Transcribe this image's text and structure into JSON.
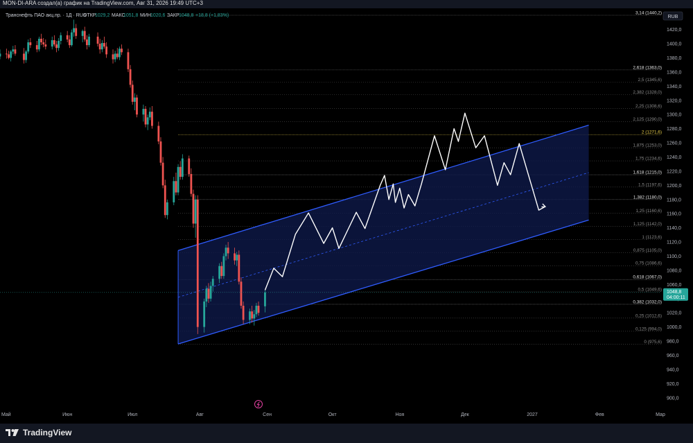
{
  "header": {
    "attribution": "MON-DI-ARA создал(а) график на TradingView.com, Авг 31, 2026 19:49 UTC+3"
  },
  "legend": {
    "symbol": "Транснефть ПАО акц.пр. · 1Д · RUS",
    "open_label": "ОТКР",
    "open": "1029,2",
    "high_label": "МАКС",
    "high": "1051,8",
    "low_label": "МИН",
    "low": "1020,6",
    "close_label": "ЗАКР",
    "close": "1048,8",
    "change": "+18,8 (+1,83%)"
  },
  "footer": {
    "brand": "TradingView"
  },
  "colors": {
    "background": "#000000",
    "up": "#26a69a",
    "down": "#ef5350",
    "channel_line": "#2f5cff",
    "channel_fill": "#0e1a4a",
    "forecast": "#ffffff",
    "fib_line": "#8a8a8a",
    "price_tag": "#26a69a"
  },
  "chart_data": {
    "type": "candlestick",
    "currency": "RUB",
    "y_axis": {
      "range": [
        890,
        1450
      ],
      "ticks": [
        "1420,0",
        "1400,0",
        "1380,0",
        "1360,0",
        "1340,0",
        "1320,0",
        "1300,0",
        "1280,0",
        "1260,0",
        "1240,0",
        "1220,0",
        "1200,0",
        "1180,0",
        "1160,0",
        "1140,0",
        "1120,0",
        "1100,0",
        "1080,0",
        "1060,0",
        "1040,0",
        "1020,0",
        "1000,0",
        "980,0",
        "960,0",
        "940,0",
        "920,0",
        "900,0"
      ]
    },
    "x_axis": {
      "range": [
        "2026-05-01",
        "2027-03-01"
      ],
      "ticks": [
        {
          "date": "2026-05-01",
          "label": "Май"
        },
        {
          "date": "2026-06-01",
          "label": "Июн"
        },
        {
          "date": "2026-07-01",
          "label": "Июл"
        },
        {
          "date": "2026-08-01",
          "label": "Авг"
        },
        {
          "date": "2026-09-01",
          "label": "Сен"
        },
        {
          "date": "2026-10-01",
          "label": "Окт"
        },
        {
          "date": "2026-11-01",
          "label": "Ноя"
        },
        {
          "date": "2026-12-01",
          "label": "Дек"
        },
        {
          "date": "2027-01-01",
          "label": "2027"
        },
        {
          "date": "2027-02-01",
          "label": "Фев"
        },
        {
          "date": "2027-03-01",
          "label": "Мар"
        }
      ]
    },
    "last_price": {
      "value": 1048.8,
      "label": "1048,8",
      "countdown": "04:00:11"
    },
    "fibonacci": [
      {
        "level": "0",
        "price": 975.6,
        "label": "0 (975,6)",
        "emphasis": false
      },
      {
        "level": "0.125",
        "price": 994.0,
        "label": "0,125 (994,0)",
        "emphasis": false
      },
      {
        "level": "0.25",
        "price": 1012.6,
        "label": "0,25 (1012,6)",
        "emphasis": false
      },
      {
        "level": "0.382",
        "price": 1032.0,
        "label": "0,382 (1032,0)",
        "emphasis": true
      },
      {
        "level": "0.5",
        "price": 1049.6,
        "label": "0,5 (1049,6)",
        "emphasis": false
      },
      {
        "level": "0.618",
        "price": 1067.0,
        "label": "0,618 (1067,0)",
        "emphasis": true
      },
      {
        "level": "0.75",
        "price": 1086.6,
        "label": "0,75 (1086,6)",
        "emphasis": false
      },
      {
        "level": "0.875",
        "price": 1105.0,
        "label": "0,875 (1105,0)",
        "emphasis": false
      },
      {
        "level": "1",
        "price": 1123.6,
        "label": "1 (1123,6)",
        "emphasis": false
      },
      {
        "level": "1.125",
        "price": 1142.0,
        "label": "1,125 (1142,0)",
        "emphasis": false
      },
      {
        "level": "1.25",
        "price": 1160.6,
        "label": "1,25 (1160,6)",
        "emphasis": false
      },
      {
        "level": "1.382",
        "price": 1180.0,
        "label": "1,382 (1180,0)",
        "emphasis": true
      },
      {
        "level": "1.5",
        "price": 1197.6,
        "label": "1,5 (1197,6)",
        "emphasis": false
      },
      {
        "level": "1.618",
        "price": 1215.0,
        "label": "1,618 (1215,0)",
        "emphasis": true
      },
      {
        "level": "1.75",
        "price": 1234.6,
        "label": "1,75 (1234,6)",
        "emphasis": false
      },
      {
        "level": "1.875",
        "price": 1253.0,
        "label": "1,875 (1253,0)",
        "emphasis": false
      },
      {
        "level": "2",
        "price": 1271.6,
        "label": "2 (1271,6)",
        "emphasis": true,
        "color": "#f0d44a"
      },
      {
        "level": "2.125",
        "price": 1290.0,
        "label": "2,125 (1290,0)",
        "emphasis": false
      },
      {
        "level": "2.25",
        "price": 1308.6,
        "label": "2,25 (1308,6)",
        "emphasis": false
      },
      {
        "level": "2.382",
        "price": 1328.0,
        "label": "2,382 (1328,0)",
        "emphasis": false
      },
      {
        "level": "2.5",
        "price": 1345.6,
        "label": "2,5 (1345,6)",
        "emphasis": false
      },
      {
        "level": "2.618",
        "price": 1363.0,
        "label": "2,618 (1363,0)",
        "emphasis": true
      },
      {
        "level": "3.14",
        "price": 1440.2,
        "label": "3,14 (1440,2)",
        "emphasis": true
      }
    ],
    "channel": {
      "upper": [
        {
          "date": "2026-07-22",
          "price": 1108
        },
        {
          "date": "2027-01-27",
          "price": 1285
        }
      ],
      "middle": [
        {
          "date": "2026-07-22",
          "price": 1042
        },
        {
          "date": "2027-01-27",
          "price": 1218
        }
      ],
      "lower": [
        {
          "date": "2026-07-22",
          "price": 976
        },
        {
          "date": "2027-01-27",
          "price": 1151
        }
      ]
    },
    "forecast_path": [
      {
        "date": "2026-08-31",
        "price": 1052
      },
      {
        "date": "2026-09-04",
        "price": 1083
      },
      {
        "date": "2026-09-08",
        "price": 1071
      },
      {
        "date": "2026-09-14",
        "price": 1131
      },
      {
        "date": "2026-09-20",
        "price": 1161
      },
      {
        "date": "2026-09-27",
        "price": 1118
      },
      {
        "date": "2026-10-01",
        "price": 1140
      },
      {
        "date": "2026-10-04",
        "price": 1111
      },
      {
        "date": "2026-10-12",
        "price": 1162
      },
      {
        "date": "2026-10-16",
        "price": 1139
      },
      {
        "date": "2026-10-23",
        "price": 1200
      },
      {
        "date": "2026-10-25",
        "price": 1214
      },
      {
        "date": "2026-10-27",
        "price": 1180
      },
      {
        "date": "2026-10-29",
        "price": 1202
      },
      {
        "date": "2026-10-30",
        "price": 1176
      },
      {
        "date": "2026-11-01",
        "price": 1196
      },
      {
        "date": "2026-11-03",
        "price": 1168
      },
      {
        "date": "2026-11-05",
        "price": 1187
      },
      {
        "date": "2026-11-08",
        "price": 1171
      },
      {
        "date": "2026-11-11",
        "price": 1202
      },
      {
        "date": "2026-11-17",
        "price": 1270
      },
      {
        "date": "2026-11-22",
        "price": 1222
      },
      {
        "date": "2026-11-26",
        "price": 1280
      },
      {
        "date": "2026-11-28",
        "price": 1262
      },
      {
        "date": "2026-12-01",
        "price": 1302
      },
      {
        "date": "2026-12-06",
        "price": 1253
      },
      {
        "date": "2026-12-10",
        "price": 1270
      },
      {
        "date": "2026-12-16",
        "price": 1200
      },
      {
        "date": "2026-12-19",
        "price": 1232
      },
      {
        "date": "2026-12-22",
        "price": 1215
      },
      {
        "date": "2026-12-26",
        "price": 1259
      },
      {
        "date": "2027-01-04",
        "price": 1165
      },
      {
        "date": "2027-01-07",
        "price": 1170
      }
    ],
    "candles": [
      {
        "d": "2026-05-01",
        "o": 1382,
        "h": 1392,
        "l": 1378,
        "c": 1386
      },
      {
        "d": "2026-05-04",
        "o": 1386,
        "h": 1393,
        "l": 1379,
        "c": 1385
      },
      {
        "d": "2026-05-05",
        "o": 1385,
        "h": 1390,
        "l": 1378,
        "c": 1380
      },
      {
        "d": "2026-05-06",
        "o": 1380,
        "h": 1391,
        "l": 1375,
        "c": 1389
      },
      {
        "d": "2026-05-07",
        "o": 1389,
        "h": 1397,
        "l": 1385,
        "c": 1392
      },
      {
        "d": "2026-05-08",
        "o": 1392,
        "h": 1398,
        "l": 1383,
        "c": 1386
      },
      {
        "d": "2026-05-12",
        "o": 1386,
        "h": 1394,
        "l": 1372,
        "c": 1377
      },
      {
        "d": "2026-05-13",
        "o": 1377,
        "h": 1391,
        "l": 1373,
        "c": 1389
      },
      {
        "d": "2026-05-14",
        "o": 1389,
        "h": 1406,
        "l": 1386,
        "c": 1402
      },
      {
        "d": "2026-05-15",
        "o": 1402,
        "h": 1408,
        "l": 1394,
        "c": 1398
      },
      {
        "d": "2026-05-18",
        "o": 1398,
        "h": 1404,
        "l": 1388,
        "c": 1392
      },
      {
        "d": "2026-05-19",
        "o": 1392,
        "h": 1410,
        "l": 1389,
        "c": 1407
      },
      {
        "d": "2026-05-20",
        "o": 1407,
        "h": 1414,
        "l": 1398,
        "c": 1402
      },
      {
        "d": "2026-05-21",
        "o": 1402,
        "h": 1408,
        "l": 1395,
        "c": 1399
      },
      {
        "d": "2026-05-22",
        "o": 1399,
        "h": 1406,
        "l": 1392,
        "c": 1396
      },
      {
        "d": "2026-05-25",
        "o": 1396,
        "h": 1410,
        "l": 1392,
        "c": 1405
      },
      {
        "d": "2026-05-26",
        "o": 1405,
        "h": 1412,
        "l": 1396,
        "c": 1399
      },
      {
        "d": "2026-05-27",
        "o": 1399,
        "h": 1404,
        "l": 1388,
        "c": 1394
      },
      {
        "d": "2026-05-28",
        "o": 1394,
        "h": 1408,
        "l": 1390,
        "c": 1404
      },
      {
        "d": "2026-05-29",
        "o": 1404,
        "h": 1416,
        "l": 1399,
        "c": 1412
      },
      {
        "d": "2026-06-01",
        "o": 1412,
        "h": 1418,
        "l": 1402,
        "c": 1406
      },
      {
        "d": "2026-06-02",
        "o": 1406,
        "h": 1412,
        "l": 1394,
        "c": 1398
      },
      {
        "d": "2026-06-03",
        "o": 1398,
        "h": 1420,
        "l": 1396,
        "c": 1416
      },
      {
        "d": "2026-06-04",
        "o": 1416,
        "h": 1434,
        "l": 1410,
        "c": 1422
      },
      {
        "d": "2026-06-05",
        "o": 1422,
        "h": 1428,
        "l": 1407,
        "c": 1411
      },
      {
        "d": "2026-06-08",
        "o": 1411,
        "h": 1420,
        "l": 1402,
        "c": 1418
      },
      {
        "d": "2026-06-09",
        "o": 1418,
        "h": 1424,
        "l": 1403,
        "c": 1406
      },
      {
        "d": "2026-06-10",
        "o": 1406,
        "h": 1412,
        "l": 1392,
        "c": 1398
      },
      {
        "d": "2026-06-11",
        "o": 1398,
        "h": 1414,
        "l": 1395,
        "c": 1410
      },
      {
        "d": "2026-06-15",
        "o": 1410,
        "h": 1416,
        "l": 1396,
        "c": 1400
      },
      {
        "d": "2026-06-16",
        "o": 1400,
        "h": 1407,
        "l": 1386,
        "c": 1392
      },
      {
        "d": "2026-06-17",
        "o": 1392,
        "h": 1405,
        "l": 1388,
        "c": 1401
      },
      {
        "d": "2026-06-18",
        "o": 1401,
        "h": 1410,
        "l": 1393,
        "c": 1396
      },
      {
        "d": "2026-06-19",
        "o": 1396,
        "h": 1402,
        "l": 1380,
        "c": 1385
      },
      {
        "d": "2026-06-22",
        "o": 1385,
        "h": 1392,
        "l": 1372,
        "c": 1378
      },
      {
        "d": "2026-06-23",
        "o": 1378,
        "h": 1390,
        "l": 1374,
        "c": 1386
      },
      {
        "d": "2026-06-24",
        "o": 1386,
        "h": 1394,
        "l": 1378,
        "c": 1381
      },
      {
        "d": "2026-06-25",
        "o": 1381,
        "h": 1396,
        "l": 1377,
        "c": 1393
      },
      {
        "d": "2026-06-26",
        "o": 1393,
        "h": 1399,
        "l": 1384,
        "c": 1388
      },
      {
        "d": "2026-06-29",
        "o": 1388,
        "h": 1393,
        "l": 1360,
        "c": 1364
      },
      {
        "d": "2026-06-30",
        "o": 1364,
        "h": 1370,
        "l": 1338,
        "c": 1342
      },
      {
        "d": "2026-07-01",
        "o": 1342,
        "h": 1348,
        "l": 1314,
        "c": 1318
      },
      {
        "d": "2026-07-02",
        "o": 1318,
        "h": 1330,
        "l": 1306,
        "c": 1324
      },
      {
        "d": "2026-07-03",
        "o": 1324,
        "h": 1328,
        "l": 1296,
        "c": 1300
      },
      {
        "d": "2026-07-06",
        "o": 1300,
        "h": 1314,
        "l": 1290,
        "c": 1308
      },
      {
        "d": "2026-07-07",
        "o": 1308,
        "h": 1312,
        "l": 1282,
        "c": 1286
      },
      {
        "d": "2026-07-08",
        "o": 1286,
        "h": 1300,
        "l": 1278,
        "c": 1296
      },
      {
        "d": "2026-07-09",
        "o": 1296,
        "h": 1310,
        "l": 1292,
        "c": 1304
      },
      {
        "d": "2026-07-10",
        "o": 1304,
        "h": 1312,
        "l": 1280,
        "c": 1284
      },
      {
        "d": "2026-07-13",
        "o": 1284,
        "h": 1290,
        "l": 1258,
        "c": 1262
      },
      {
        "d": "2026-07-14",
        "o": 1262,
        "h": 1268,
        "l": 1228,
        "c": 1232
      },
      {
        "d": "2026-07-15",
        "o": 1232,
        "h": 1240,
        "l": 1196,
        "c": 1200
      },
      {
        "d": "2026-07-16",
        "o": 1200,
        "h": 1208,
        "l": 1154,
        "c": 1158
      },
      {
        "d": "2026-07-17",
        "o": 1158,
        "h": 1180,
        "l": 1152,
        "c": 1176
      },
      {
        "d": "2026-07-20",
        "o": 1176,
        "h": 1212,
        "l": 1172,
        "c": 1206
      },
      {
        "d": "2026-07-21",
        "o": 1206,
        "h": 1218,
        "l": 1186,
        "c": 1190
      },
      {
        "d": "2026-07-22",
        "o": 1190,
        "h": 1230,
        "l": 1186,
        "c": 1226
      },
      {
        "d": "2026-07-23",
        "o": 1226,
        "h": 1234,
        "l": 1208,
        "c": 1212
      },
      {
        "d": "2026-07-24",
        "o": 1212,
        "h": 1244,
        "l": 1208,
        "c": 1238
      },
      {
        "d": "2026-07-27",
        "o": 1238,
        "h": 1242,
        "l": 1212,
        "c": 1216
      },
      {
        "d": "2026-07-28",
        "o": 1216,
        "h": 1224,
        "l": 1184,
        "c": 1188
      },
      {
        "d": "2026-07-29",
        "o": 1188,
        "h": 1194,
        "l": 1140,
        "c": 1146
      },
      {
        "d": "2026-07-30",
        "o": 1146,
        "h": 1186,
        "l": 1126,
        "c": 1180
      },
      {
        "d": "2026-07-31",
        "o": 1180,
        "h": 1186,
        "l": 990,
        "c": 1000
      },
      {
        "d": "2026-08-03",
        "o": 1000,
        "h": 1040,
        "l": 992,
        "c": 1036
      },
      {
        "d": "2026-08-04",
        "o": 1036,
        "h": 1058,
        "l": 1028,
        "c": 1054
      },
      {
        "d": "2026-08-05",
        "o": 1054,
        "h": 1062,
        "l": 1034,
        "c": 1040
      },
      {
        "d": "2026-08-06",
        "o": 1040,
        "h": 1064,
        "l": 1036,
        "c": 1058
      },
      {
        "d": "2026-08-07",
        "o": 1058,
        "h": 1072,
        "l": 1050,
        "c": 1068
      },
      {
        "d": "2026-08-10",
        "o": 1068,
        "h": 1090,
        "l": 1062,
        "c": 1086
      },
      {
        "d": "2026-08-11",
        "o": 1086,
        "h": 1092,
        "l": 1068,
        "c": 1072
      },
      {
        "d": "2026-08-12",
        "o": 1072,
        "h": 1104,
        "l": 1068,
        "c": 1100
      },
      {
        "d": "2026-08-13",
        "o": 1100,
        "h": 1116,
        "l": 1094,
        "c": 1112
      },
      {
        "d": "2026-08-14",
        "o": 1112,
        "h": 1120,
        "l": 1096,
        "c": 1104
      },
      {
        "d": "2026-08-17",
        "o": 1104,
        "h": 1112,
        "l": 1088,
        "c": 1094
      },
      {
        "d": "2026-08-18",
        "o": 1094,
        "h": 1106,
        "l": 1086,
        "c": 1102
      },
      {
        "d": "2026-08-19",
        "o": 1102,
        "h": 1108,
        "l": 1060,
        "c": 1064
      },
      {
        "d": "2026-08-20",
        "o": 1064,
        "h": 1070,
        "l": 1026,
        "c": 1030
      },
      {
        "d": "2026-08-21",
        "o": 1030,
        "h": 1036,
        "l": 1004,
        "c": 1010
      },
      {
        "d": "2026-08-24",
        "o": 1010,
        "h": 1026,
        "l": 1004,
        "c": 1022
      },
      {
        "d": "2026-08-25",
        "o": 1022,
        "h": 1030,
        "l": 1006,
        "c": 1012
      },
      {
        "d": "2026-08-26",
        "o": 1012,
        "h": 1024,
        "l": 1002,
        "c": 1018
      },
      {
        "d": "2026-08-27",
        "o": 1018,
        "h": 1034,
        "l": 1014,
        "c": 1030
      },
      {
        "d": "2026-08-28",
        "o": 1030,
        "h": 1036,
        "l": 1016,
        "c": 1020
      },
      {
        "d": "2026-08-31",
        "o": 1029.2,
        "h": 1051.8,
        "l": 1020.6,
        "c": 1048.8
      }
    ]
  }
}
